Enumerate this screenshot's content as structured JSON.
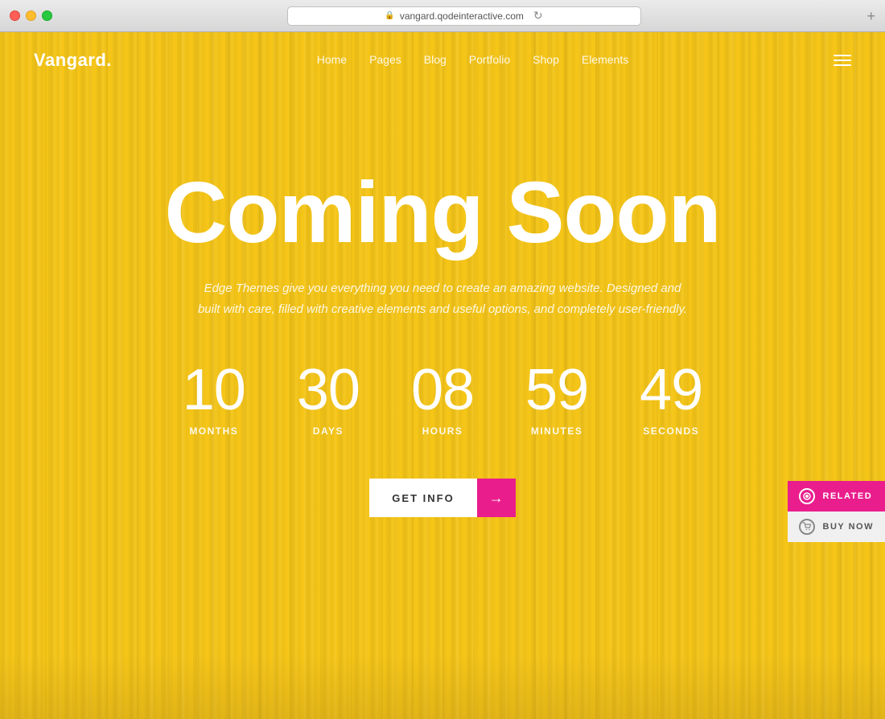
{
  "browser": {
    "url": "vangard.qodeinteractive.com",
    "add_tab": "+"
  },
  "navbar": {
    "logo": "Vangard.",
    "links": [
      "Home",
      "Pages",
      "Blog",
      "Portfolio",
      "Shop",
      "Elements"
    ]
  },
  "hero": {
    "title": "Coming Soon",
    "subtitle": "Edge Themes give you everything you need to create an amazing website. Designed and built with care, filled with creative elements and useful options, and completely user-friendly."
  },
  "countdown": [
    {
      "number": "10",
      "label": "Months"
    },
    {
      "number": "30",
      "label": "Days"
    },
    {
      "number": "08",
      "label": "Hours"
    },
    {
      "number": "59",
      "label": "Minutes"
    },
    {
      "number": "49",
      "label": "Seconds"
    }
  ],
  "cta": {
    "button_label": "GET INFO",
    "arrow": "→"
  },
  "widgets": {
    "related_label": "RELATED",
    "buy_label": "BUY NOW"
  },
  "colors": {
    "accent_pink": "#e91e8c",
    "bg_yellow": "#f5c518",
    "white": "#ffffff"
  }
}
